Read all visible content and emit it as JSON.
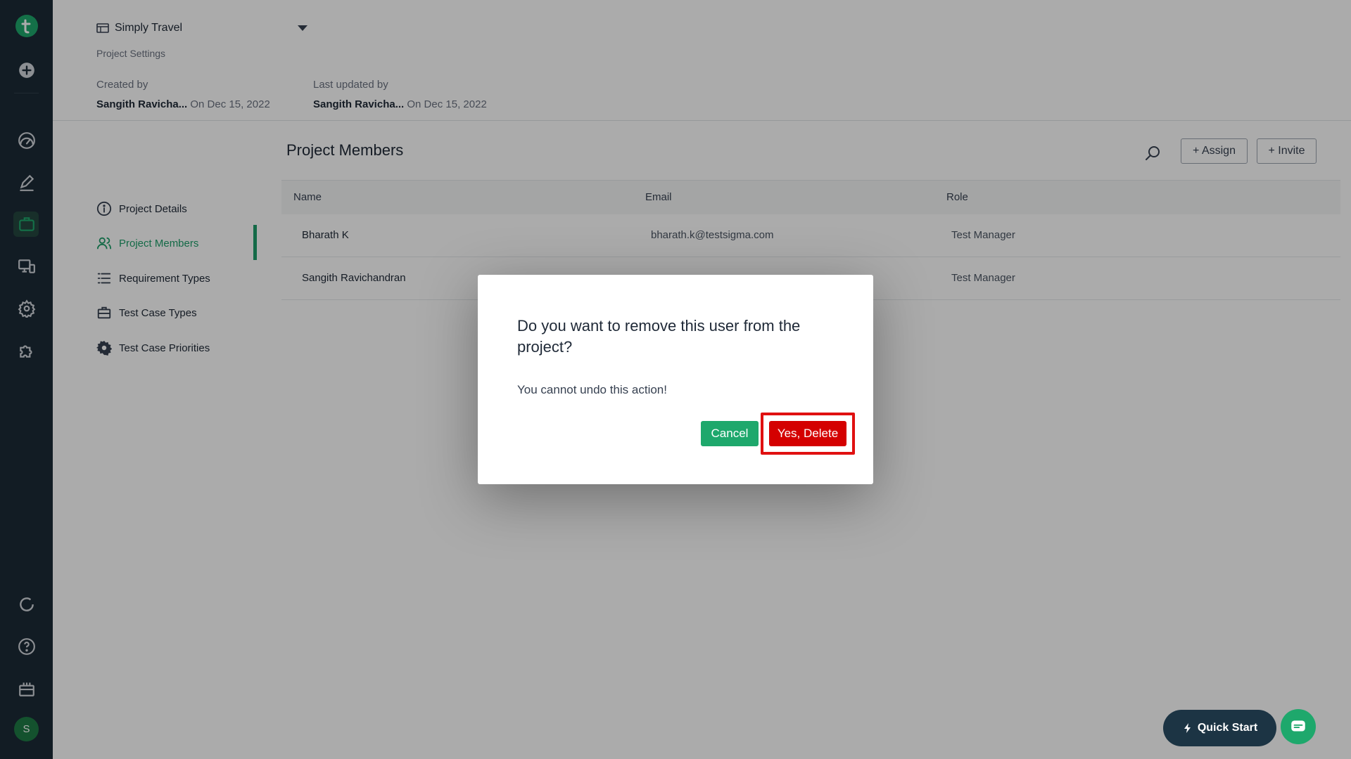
{
  "header": {
    "project_name": "Simply Travel",
    "breadcrumb": "Project Settings",
    "created_label": "Created by",
    "created_by": "Sangith Ravicha...",
    "created_on": "On Dec 15, 2022",
    "updated_label": "Last updated by",
    "updated_by": "Sangith Ravicha...",
    "updated_on": "On Dec 15, 2022"
  },
  "nav": {
    "items": [
      {
        "label": "Project Details",
        "icon": "info-icon"
      },
      {
        "label": "Project Members",
        "icon": "users-icon",
        "active": true
      },
      {
        "label": "Requirement Types",
        "icon": "list-icon"
      },
      {
        "label": "Test Case Types",
        "icon": "briefcase-icon"
      },
      {
        "label": "Test Case Priorities",
        "icon": "gear-icon"
      }
    ]
  },
  "main": {
    "title": "Project Members",
    "assign_label": "+ Assign",
    "invite_label": "+ Invite",
    "columns": [
      "Name",
      "Email",
      "Role"
    ],
    "rows": [
      {
        "name": "Bharath K",
        "email": "bharath.k@testsigma.com",
        "role": "Test Manager"
      },
      {
        "name": "Sangith Ravichandran",
        "email": "",
        "role": "Test Manager"
      }
    ]
  },
  "modal": {
    "title": "Do you want to remove this user from the project?",
    "message": "You cannot undo this action!",
    "cancel_label": "Cancel",
    "confirm_label": "Yes, Delete"
  },
  "floating": {
    "quick_start_label": "Quick Start"
  },
  "user": {
    "avatar_initial": "S"
  },
  "colors": {
    "accent": "#1ea86c",
    "danger": "#d40000",
    "rail": "#1c2a36"
  }
}
